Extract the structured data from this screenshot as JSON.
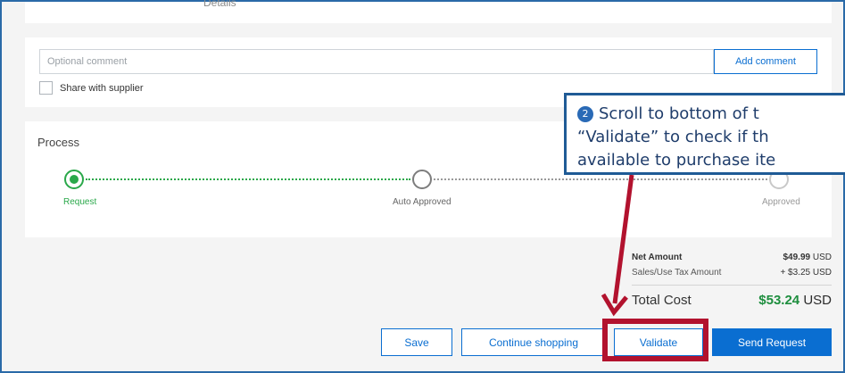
{
  "top_partial_text": "Details",
  "comment": {
    "placeholder": "Optional comment",
    "value": "",
    "add_label": "Add comment",
    "share_label": "Share with supplier"
  },
  "process": {
    "title": "Process",
    "steps": [
      {
        "label": "Request",
        "state": "active"
      },
      {
        "label": "Auto Approved",
        "state": "pending"
      },
      {
        "label": "Approved",
        "state": "pending"
      }
    ]
  },
  "summary": {
    "net_label": "Net Amount",
    "net_value": "$49.99",
    "net_currency": "USD",
    "tax_label": "Sales/Use Tax Amount",
    "tax_value": "+ $3.25",
    "tax_currency": "USD",
    "total_label": "Total Cost",
    "total_value": "$53.24",
    "total_currency": "USD"
  },
  "actions": {
    "save": "Save",
    "continue": "Continue shopping",
    "validate": "Validate",
    "send": "Send Request"
  },
  "callout": {
    "number": "2",
    "line1": "Scroll to bottom of t",
    "line2": "“Validate” to check if th",
    "line3": "available to purchase ite"
  },
  "colors": {
    "accent": "#0a6ed1",
    "success": "#2aa84a",
    "highlight": "#b2122e",
    "callout_border": "#1f5b96"
  }
}
